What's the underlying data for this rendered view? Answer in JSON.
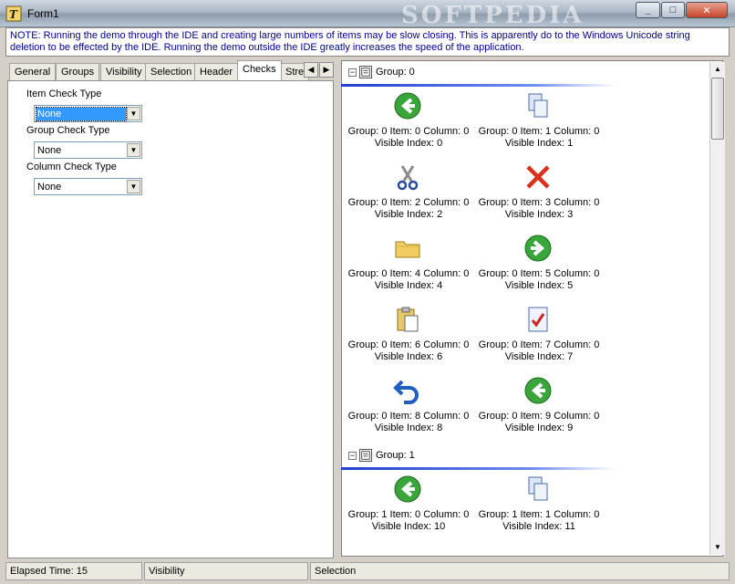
{
  "window": {
    "title": "Form1",
    "watermark": "SOFTPEDIA",
    "buttons": {
      "minimize": "_",
      "maximize": "□",
      "close": "✕"
    }
  },
  "note": "NOTE:  Running the demo through the IDE and creating large numbers of items may be slow closing.  This is apparently do to the Windows Unicode string deletion to be effected by the IDE.  Running the demo outside the IDE greatly increases the speed of the application.",
  "tabs": [
    "General",
    "Groups",
    "Visibility",
    "Selection",
    "Header",
    "Checks",
    "Stre"
  ],
  "active_tab": "Checks",
  "tab_scroll": {
    "left": "◀",
    "right": "▶"
  },
  "checks": {
    "item_check_type": {
      "label": "Item Check Type",
      "value": "None"
    },
    "group_check_type": {
      "label": "Group Check Type",
      "value": "None"
    },
    "column_check_type": {
      "label": "Column Check Type",
      "value": "None"
    }
  },
  "list": {
    "groups": [
      {
        "label": "Group: 0",
        "toggle": "−",
        "items": [
          {
            "icon": "back-arrow-icon",
            "line1": "Group: 0 Item: 0 Column: 0",
            "line2": "Visible Index: 0"
          },
          {
            "icon": "copy-icon",
            "line1": "Group: 0 Item: 1 Column: 0",
            "line2": "Visible Index: 1"
          },
          {
            "icon": "scissors-icon",
            "line1": "Group: 0 Item: 2 Column: 0",
            "line2": "Visible Index: 2"
          },
          {
            "icon": "delete-x-icon",
            "line1": "Group: 0 Item: 3 Column: 0",
            "line2": "Visible Index: 3"
          },
          {
            "icon": "folder-icon",
            "line1": "Group: 0 Item: 4 Column: 0",
            "line2": "Visible Index: 4"
          },
          {
            "icon": "forward-arrow-icon",
            "line1": "Group: 0 Item: 5 Column: 0",
            "line2": "Visible Index: 5"
          },
          {
            "icon": "paste-icon",
            "line1": "Group: 0 Item: 6 Column: 0",
            "line2": "Visible Index: 6"
          },
          {
            "icon": "checked-document-icon",
            "line1": "Group: 0 Item: 7 Column: 0",
            "line2": "Visible Index: 7"
          },
          {
            "icon": "undo-icon",
            "line1": "Group: 0 Item: 8 Column: 0",
            "line2": "Visible Index: 8"
          },
          {
            "icon": "back-arrow-icon",
            "line1": "Group: 0 Item: 9 Column: 0",
            "line2": "Visible Index: 9"
          }
        ]
      },
      {
        "label": "Group: 1",
        "toggle": "−",
        "items": [
          {
            "icon": "back-arrow-icon",
            "line1": "Group: 1 Item: 0 Column: 0",
            "line2": "Visible Index: 10"
          },
          {
            "icon": "copy-icon",
            "line1": "Group: 1 Item: 1 Column: 0",
            "line2": "Visible Index: 11"
          }
        ]
      }
    ]
  },
  "scrollbar": {
    "up": "▲",
    "down": "▼"
  },
  "status": {
    "elapsed": "Elapsed Time: 15",
    "panel2": "Visibility",
    "panel3": "Selection"
  }
}
